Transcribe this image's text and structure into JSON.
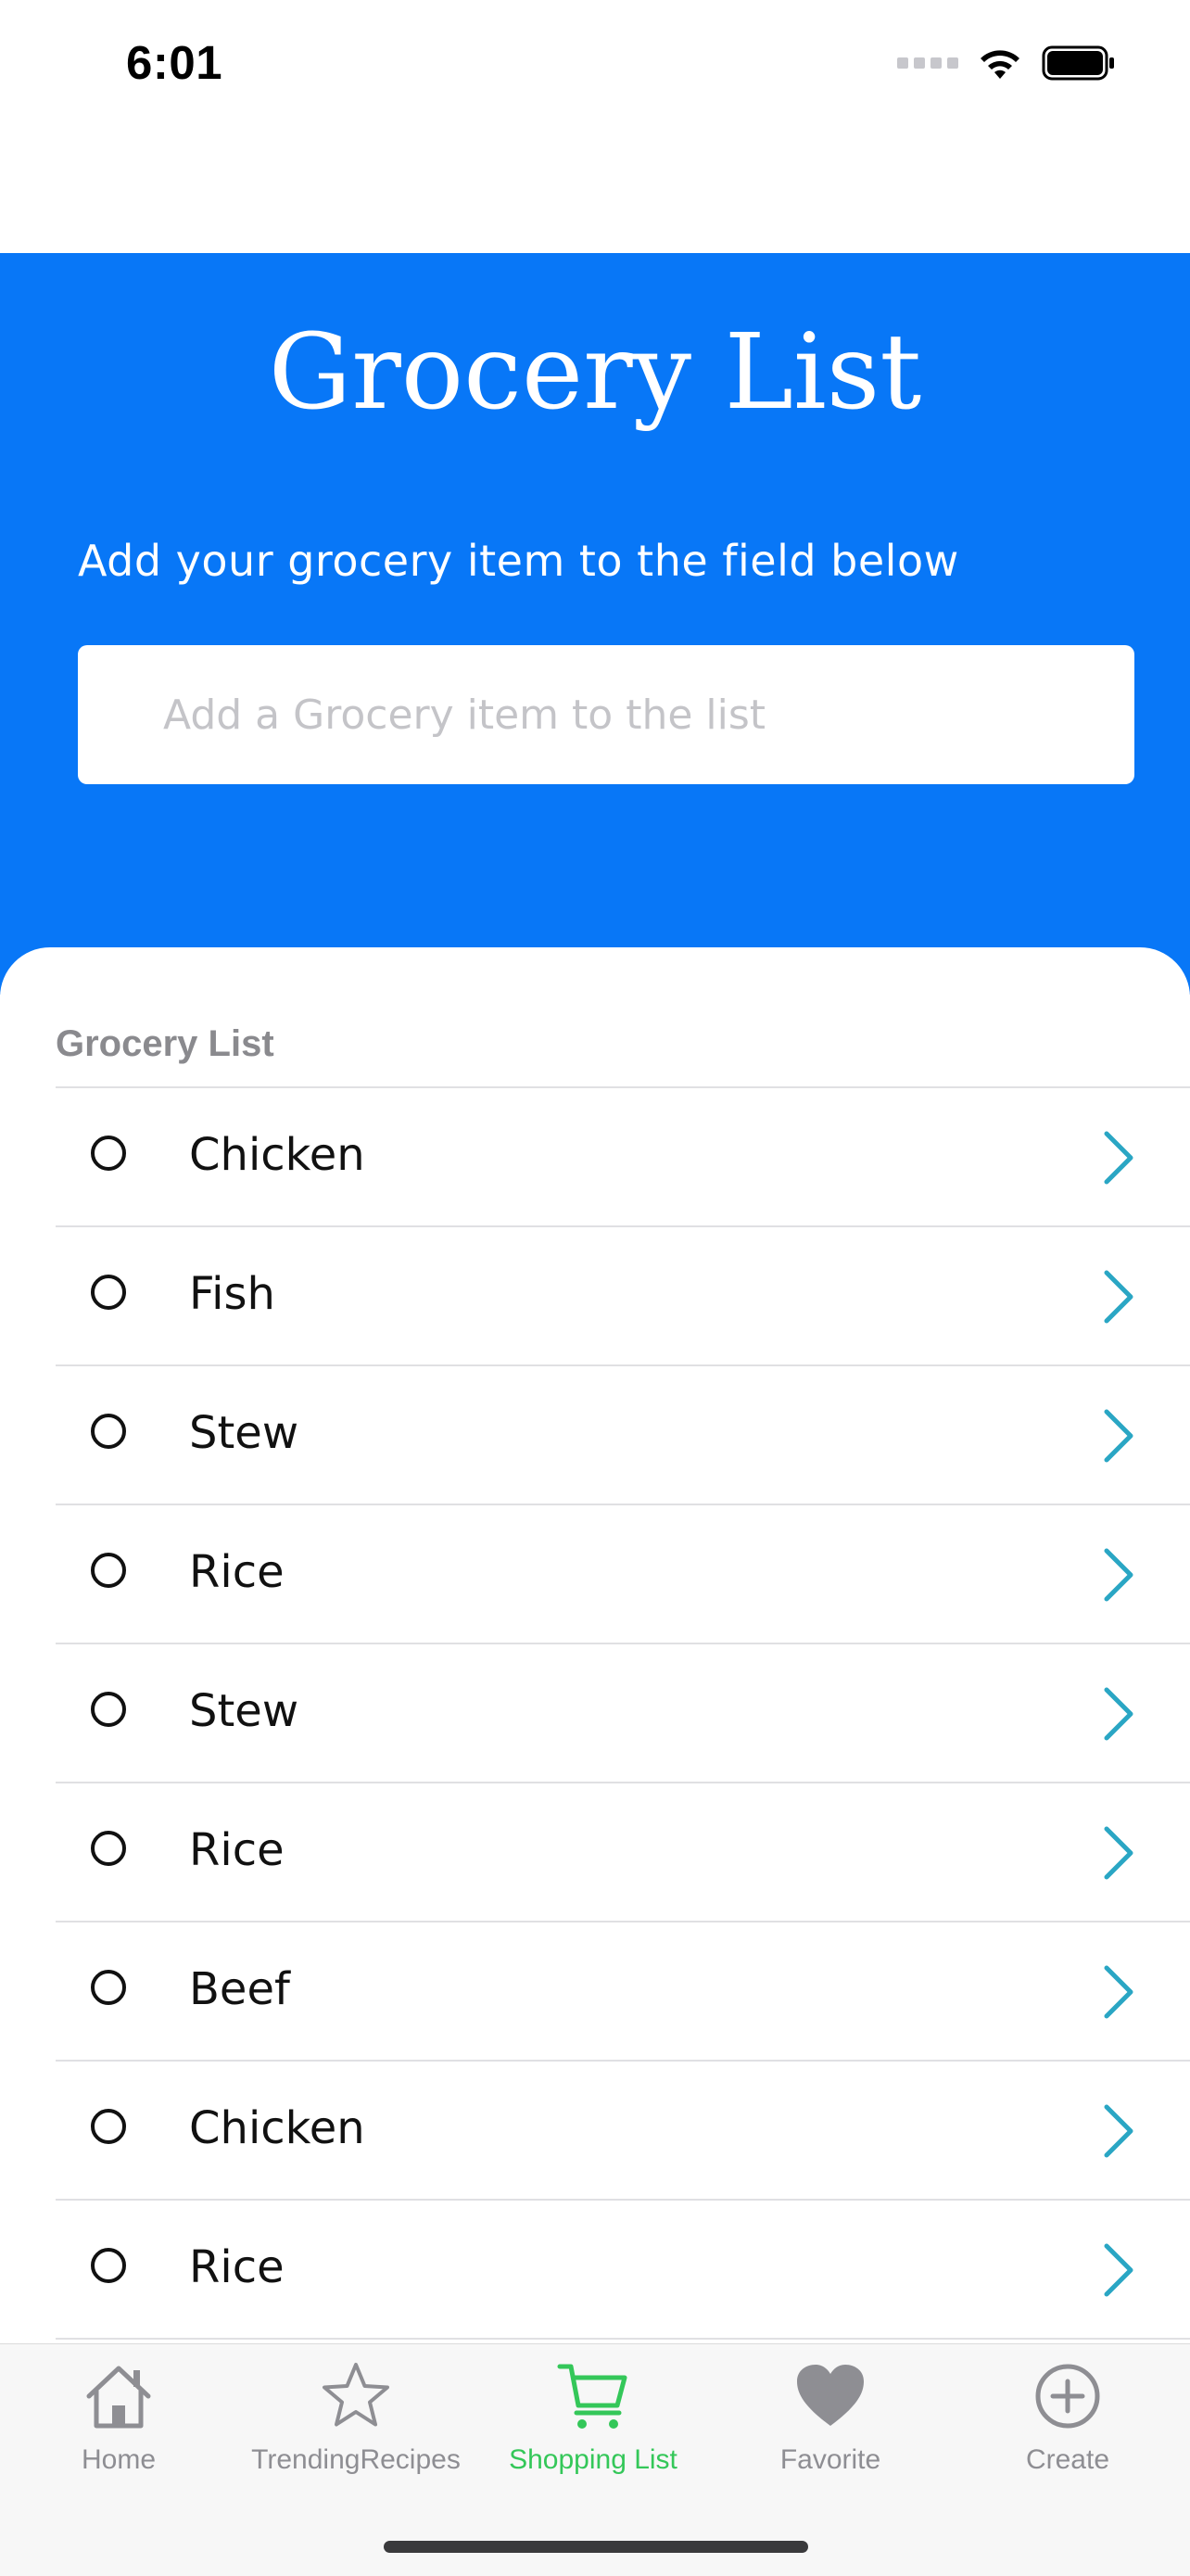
{
  "status_bar": {
    "time": "6:01"
  },
  "header": {
    "title": "Grocery List",
    "subtitle": "Add your grocery item to the field below",
    "input_placeholder": "Add a Grocery item to the list",
    "background_color": "#0877f7"
  },
  "list": {
    "section_title": "Grocery List",
    "items": [
      {
        "label": "Chicken"
      },
      {
        "label": "Fish"
      },
      {
        "label": "Stew"
      },
      {
        "label": "Rice"
      },
      {
        "label": "Stew"
      },
      {
        "label": "Rice"
      },
      {
        "label": "Beef"
      },
      {
        "label": "Chicken"
      },
      {
        "label": "Rice"
      }
    ],
    "chevron_color": "#2aa6c4"
  },
  "tab_bar": {
    "active_color": "#34c759",
    "inactive_color": "#8e8e93",
    "tabs": [
      {
        "label": "Home",
        "icon": "house-icon"
      },
      {
        "label": "TrendingRecipes",
        "icon": "star-icon"
      },
      {
        "label": "Shopping List",
        "icon": "cart-icon",
        "active": true
      },
      {
        "label": "Favorite",
        "icon": "heart-icon"
      },
      {
        "label": "Create",
        "icon": "plus-circle-icon"
      }
    ]
  }
}
